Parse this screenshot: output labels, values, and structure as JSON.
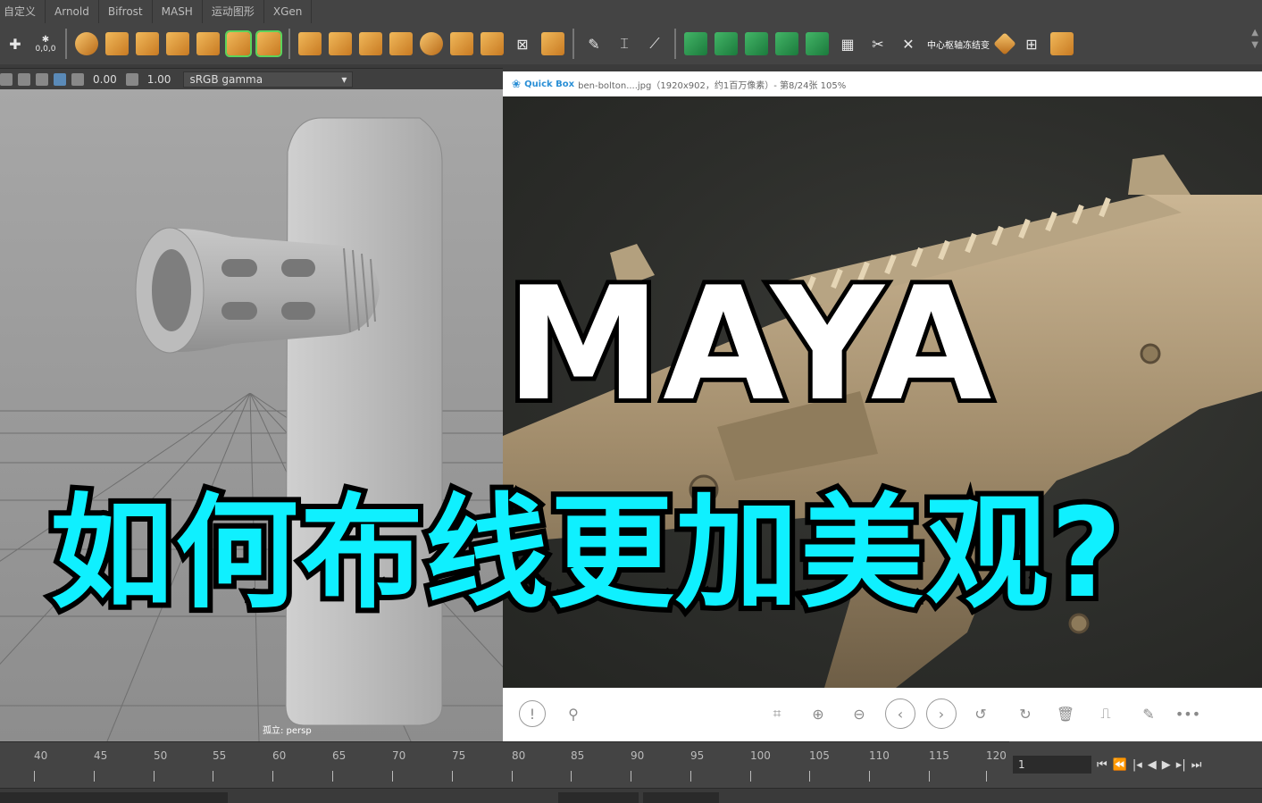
{
  "shelf": {
    "tabs": [
      "自定义",
      "Arnold",
      "Bifrost",
      "MASH",
      "运动图形",
      "XGen"
    ],
    "status_text": "0,0,0",
    "pivot_label": "中心枢轴冻结变"
  },
  "viewport": {
    "exposure": "0.00",
    "gamma": "1.00",
    "color_space": "sRGB gamma",
    "camera_label": "孤立: persp"
  },
  "viewer": {
    "app_name": "Quick Box",
    "title": "ben-bolton....jpg（1920x902，约1百万像素）- 第8/24张 105%"
  },
  "timeline": {
    "ticks": [
      "40",
      "45",
      "50",
      "55",
      "60",
      "65",
      "70",
      "75",
      "80",
      "85",
      "90",
      "95",
      "100",
      "105",
      "110",
      "115",
      "120"
    ],
    "current_frame": "1"
  },
  "overlay": {
    "title": "MAYA",
    "subtitle": "如何布线更加美观?"
  },
  "colors": {
    "subtitle": "#0ff0ff",
    "title": "#ffffff",
    "maya_ui": "#444444"
  }
}
